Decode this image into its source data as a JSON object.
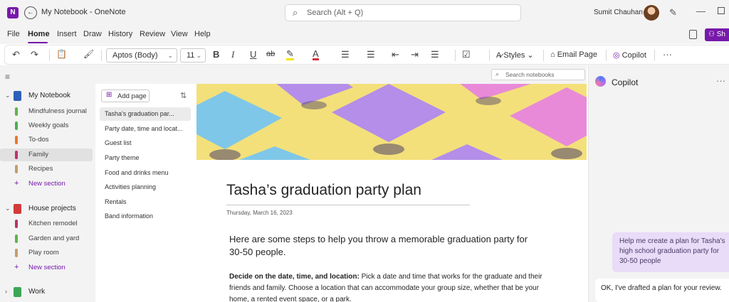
{
  "titlebar": {
    "app_logo": "N",
    "window_title": "My Notebook - OneNote",
    "search_placeholder": "Search (Alt + Q)",
    "user_name": "Sumit Chauhan",
    "icons": [
      "onenote-logo-icon",
      "back-icon",
      "search-icon",
      "avatar",
      "pen-icon",
      "minimize-icon",
      "maximize-icon"
    ]
  },
  "menu": {
    "tabs": [
      "File",
      "Home",
      "Insert",
      "Draw",
      "History",
      "Review",
      "View",
      "Help"
    ],
    "active_tab": "Home",
    "share_label": "Sh"
  },
  "ribbon": {
    "undo": "↶",
    "redo": "↷",
    "paste": "📋",
    "format_painter": "🖌",
    "font_name": "Aptos (Body)",
    "font_size": "11",
    "bold": "B",
    "italic": "I",
    "underline": "U",
    "strikethrough": "ab",
    "highlight": "✎",
    "font_color": "A",
    "bullets": "☰",
    "numbering": "☰",
    "outdent": "⇤",
    "indent": "⇥",
    "align": "☰",
    "tag": "☑",
    "styles_label": "Styles",
    "email_label": "Email Page",
    "copilot_label": "Copilot",
    "more": "···",
    "accent_color": "#7719aa"
  },
  "navigation": {
    "search_notebooks_placeholder": "Search notebooks",
    "notebooks": [
      {
        "name": "My Notebook",
        "expanded": true,
        "color": "#2f5fb8",
        "sections": [
          {
            "name": "Mindfulness journal",
            "color": "#5fb44a"
          },
          {
            "name": "Weekly goals",
            "color": "#4caf50"
          },
          {
            "name": "To-dos",
            "color": "#e8782f"
          },
          {
            "name": "Family",
            "color": "#c0306b",
            "selected": true
          },
          {
            "name": "Recipes",
            "color": "#c69c6d"
          }
        ],
        "new_section": "New section"
      },
      {
        "name": "House projects",
        "expanded": true,
        "color": "#d23b3b",
        "sections": [
          {
            "name": "Kitchen remodel",
            "color": "#b8336a"
          },
          {
            "name": "Garden and yard",
            "color": "#5fb44a"
          },
          {
            "name": "Play room",
            "color": "#c69c6d"
          }
        ],
        "new_section": "New section"
      },
      {
        "name": "Work",
        "expanded": false,
        "color": "#3aa757",
        "sections": []
      }
    ]
  },
  "pages": {
    "add_page_label": "Add page",
    "items": [
      {
        "title": "Tasha's graduation par...",
        "selected": true
      },
      {
        "title": "Party date, time and locat..."
      },
      {
        "title": "Guest list"
      },
      {
        "title": "Party theme"
      },
      {
        "title": "Food and drinks menu"
      },
      {
        "title": "Activities planning"
      },
      {
        "title": "Rentals"
      },
      {
        "title": "Band information"
      }
    ]
  },
  "page": {
    "title": "Tasha’s graduation party plan",
    "date": "Thursday, March 16, 2023",
    "intro": "Here are some steps to help you throw a memorable graduation party for 30-50 people.",
    "step_heading": "Decide on the date, time, and location:",
    "step_text": " Pick a date and time that works for the graduate and their friends and family. Choose a location that can accommodate your group size, whether that be your home, a rented event space, or a park.",
    "banner_colors": [
      "#f3e07a",
      "#7fc7e8",
      "#b48ee8",
      "#e88ad8"
    ]
  },
  "copilot": {
    "title": "Copilot",
    "more": "···",
    "user_message": "Help me create a plan for Tasha's high school graduation party for 30-50 people",
    "bot_message": "OK, I've drafted a plan for your review."
  }
}
